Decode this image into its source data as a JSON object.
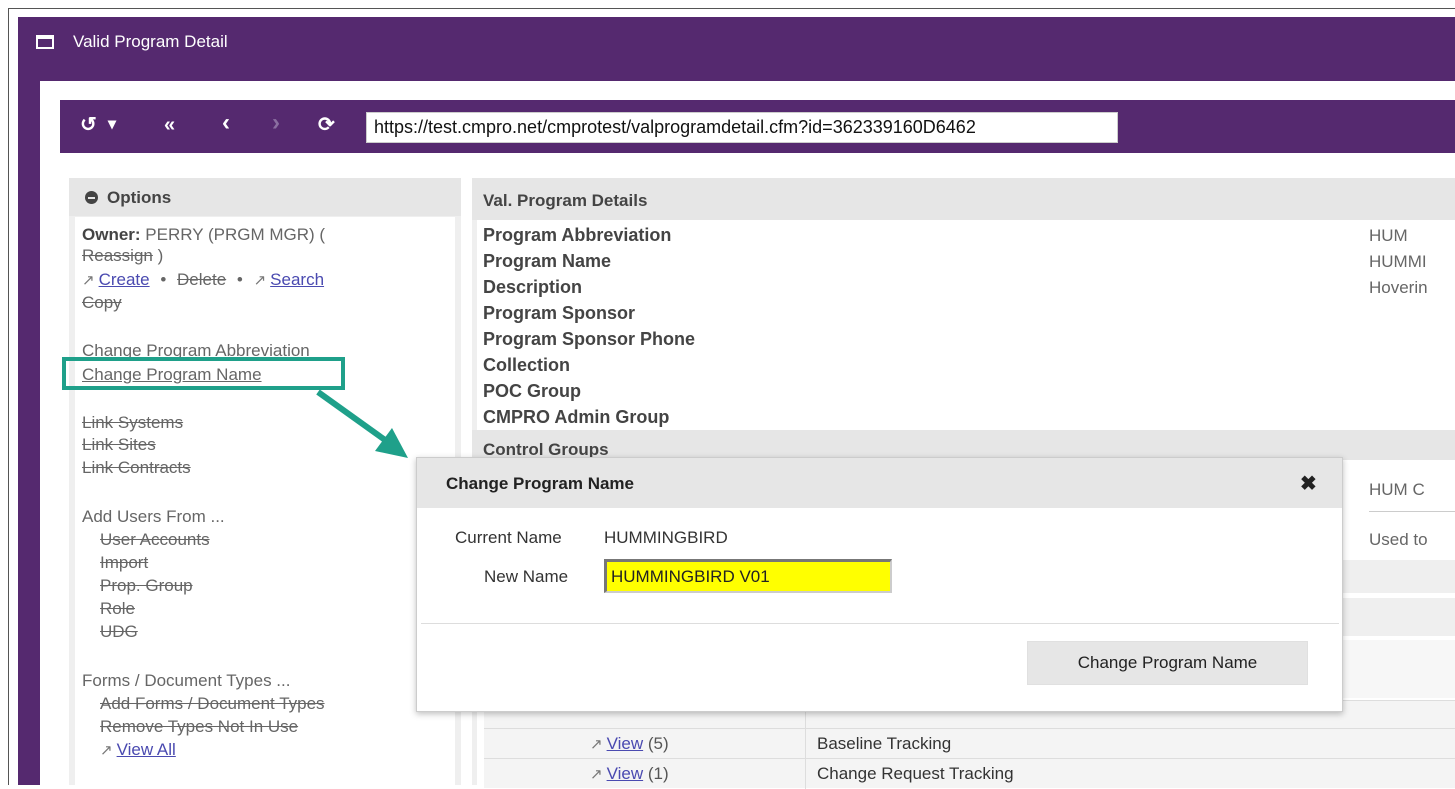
{
  "window": {
    "title": "Valid Program Detail"
  },
  "navbar": {
    "history_icon": "↺",
    "dropdown_icon": "▾",
    "first_icon": "«",
    "back_icon": "‹",
    "forward_icon": "›",
    "refresh_icon": "⟳",
    "url": "https://test.cmpro.net/cmprotest/valprogramdetail.cfm?id=362339160D6462"
  },
  "options": {
    "header": "Options",
    "owner_label": "Owner:",
    "owner_value": "PERRY (PRGM MGR) (",
    "reassign": "Reassign",
    "reassign_close": ")",
    "create": "Create",
    "bullet": "•",
    "delete": "Delete",
    "search": "Search",
    "copy": "Copy",
    "change_abbrev": "Change Program Abbreviation",
    "change_name": "Change Program Name",
    "link_systems": "Link Systems",
    "link_sites": "Link Sites",
    "link_contracts": "Link Contracts",
    "add_users_from": "Add Users From ...",
    "user_accounts": "User Accounts",
    "import": "Import",
    "prop_group": "Prop. Group",
    "role": "Role",
    "udg": "UDG",
    "forms_doc_types": "Forms / Document Types ...",
    "add_forms": "Add Forms / Document Types",
    "remove_types": "Remove Types Not In Use",
    "view_all": "View All"
  },
  "details": {
    "header": "Val. Program Details",
    "fields": [
      {
        "label": "Program Abbreviation",
        "value": "HUM"
      },
      {
        "label": "Program Name",
        "value": "HUMMI"
      },
      {
        "label": "Description",
        "value": "Hoverin"
      },
      {
        "label": "Program Sponsor",
        "value": ""
      },
      {
        "label": "Program Sponsor Phone",
        "value": ""
      },
      {
        "label": "Collection",
        "value": ""
      },
      {
        "label": "POC Group",
        "value": ""
      },
      {
        "label": "CMPRO Admin Group",
        "value": ""
      }
    ],
    "control_groups": "Control Groups",
    "hum_c": "HUM C",
    "used_to": "Used to"
  },
  "table_rows": [
    {
      "view": "View",
      "count": "(5)",
      "desc": "Baseline Tracking"
    },
    {
      "view": "View",
      "count": "(1)",
      "desc": "Change Request Tracking"
    }
  ],
  "modal": {
    "title": "Change Program Name",
    "current_name_label": "Current Name",
    "current_name_value": "HUMMINGBIRD",
    "new_name_label": "New Name",
    "new_name_value": "HUMMINGBIRD V01",
    "button": "Change Program Name",
    "close_icon": "✖"
  },
  "colors": {
    "brand_purple": "#55296f",
    "highlight_teal": "#1fa08a",
    "input_highlight": "#ffff00"
  }
}
